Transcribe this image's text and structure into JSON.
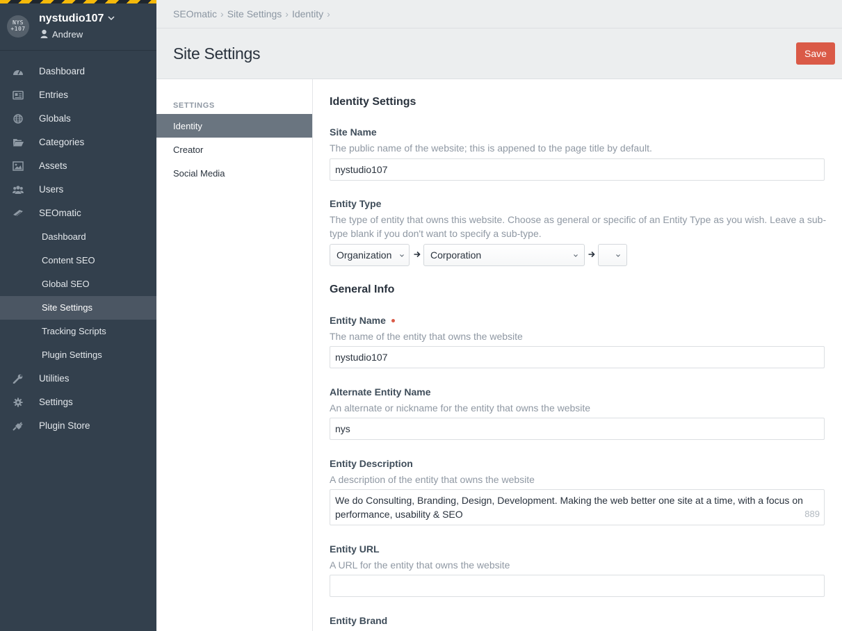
{
  "sidebar": {
    "logo_text": "NYS\n107",
    "site_name": "nystudio107",
    "user_name": "Andrew",
    "items": [
      {
        "label": "Dashboard",
        "icon": "dashboard-icon"
      },
      {
        "label": "Entries",
        "icon": "entries-icon"
      },
      {
        "label": "Globals",
        "icon": "globe-icon"
      },
      {
        "label": "Categories",
        "icon": "folder-icon"
      },
      {
        "label": "Assets",
        "icon": "image-icon"
      },
      {
        "label": "Users",
        "icon": "users-icon"
      },
      {
        "label": "SEOmatic",
        "icon": "seomatic-icon"
      }
    ],
    "subitems": [
      {
        "label": "Dashboard"
      },
      {
        "label": "Content SEO"
      },
      {
        "label": "Global SEO"
      },
      {
        "label": "Site Settings",
        "active": true
      },
      {
        "label": "Tracking Scripts"
      },
      {
        "label": "Plugin Settings"
      }
    ],
    "bottom_items": [
      {
        "label": "Utilities",
        "icon": "wrench-icon"
      },
      {
        "label": "Settings",
        "icon": "gear-icon"
      },
      {
        "label": "Plugin Store",
        "icon": "plug-icon"
      }
    ]
  },
  "breadcrumb": [
    "SEOmatic",
    "Site Settings",
    "Identity"
  ],
  "breadcrumb_sep": "›",
  "page_title": "Site Settings",
  "save_label": "Save",
  "subnav": {
    "heading": "SETTINGS",
    "items": [
      {
        "label": "Identity",
        "active": true
      },
      {
        "label": "Creator"
      },
      {
        "label": "Social Media"
      }
    ]
  },
  "form": {
    "identity_heading": "Identity Settings",
    "site_name": {
      "label": "Site Name",
      "instructions": "The public name of the website; this is appened to the page title by default.",
      "value": "nystudio107"
    },
    "entity_type": {
      "label": "Entity Type",
      "instructions": "The type of entity that owns this website. Choose as general or specific of an Entity Type as you wish. Leave a sub-type blank if you don't want to specify a sub-type.",
      "select1": "Organization",
      "select2": "Corporation",
      "select3": ""
    },
    "general_heading": "General Info",
    "entity_name": {
      "label": "Entity Name",
      "instructions": "The name of the entity that owns the website",
      "value": "nystudio107"
    },
    "alt_name": {
      "label": "Alternate Entity Name",
      "instructions": "An alternate or nickname for the entity that owns the website",
      "value": "nys"
    },
    "description": {
      "label": "Entity Description",
      "instructions": "A description of the entity that owns the website",
      "value": "We do Consulting, Branding, Design, Development. Making the web better one site at a time, with a focus on performance, usability & SEO",
      "char_count": "889"
    },
    "entity_url": {
      "label": "Entity URL",
      "instructions": "A URL for the entity that owns the website",
      "value": ""
    },
    "entity_brand": {
      "label": "Entity Brand"
    }
  },
  "colors": {
    "sidebar_bg": "#33404d",
    "active_sub_bg": "#4b5663",
    "save_button": "#da5a47",
    "subnav_active_bg": "#6a7580"
  }
}
